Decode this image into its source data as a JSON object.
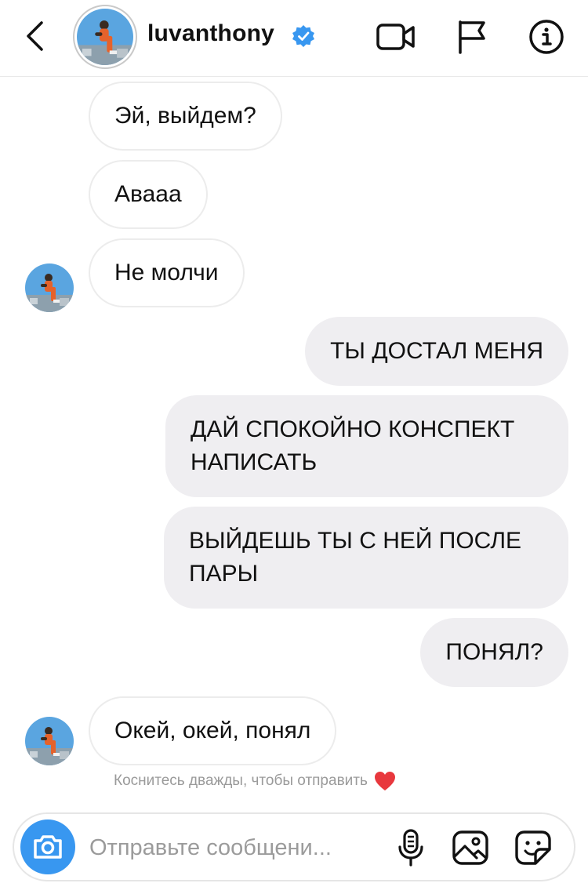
{
  "header": {
    "username": "luvanthony",
    "verified": true,
    "icons": [
      "back-chevron-icon",
      "video-call-icon",
      "flag-icon",
      "info-icon"
    ]
  },
  "messages": [
    {
      "direction": "incoming",
      "text": "Эй, выйдем?",
      "show_avatar": false
    },
    {
      "direction": "incoming",
      "text": "Аваaa",
      "show_avatar": false
    },
    {
      "direction": "incoming",
      "text": "Не молчи",
      "show_avatar": true
    },
    {
      "direction": "outgoing",
      "lines": [
        "ТЫ ДОСТАЛ МЕНЯ"
      ]
    },
    {
      "direction": "outgoing",
      "lines": [
        "ДАЙ СПОКОЙНО КОНСПЕКТ",
        "НАПИСАТЬ"
      ]
    },
    {
      "direction": "outgoing",
      "lines": [
        "ВЫЙДЕШЬ ТЫ С НЕЙ ПОСЛЕ",
        "ПАРЫ"
      ]
    },
    {
      "direction": "outgoing",
      "lines": [
        "ПОНЯЛ?"
      ]
    },
    {
      "direction": "incoming",
      "text": "Окей, окей, понял",
      "show_avatar": true
    }
  ],
  "hint": {
    "text": "Коснитесь дважды, чтобы отправить",
    "icon": "heart-icon",
    "heart_color": "#e8383d"
  },
  "composer": {
    "placeholder": "Отправьте сообщени...",
    "value": "",
    "icons": [
      "camera-icon",
      "microphone-icon",
      "gallery-icon",
      "sticker-icon"
    ],
    "camera_color": "#3897f0"
  },
  "colors": {
    "verified_badge": "#3897f0",
    "outgoing_bubble": "#efeef1",
    "incoming_border": "#ececec"
  }
}
